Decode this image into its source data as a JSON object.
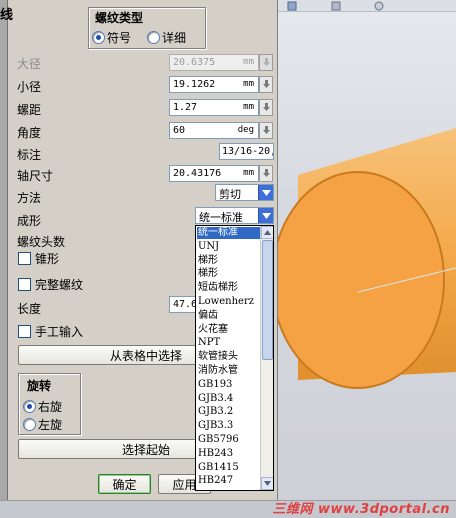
{
  "panel": {
    "title_fragment": "线",
    "thread_type": {
      "title": "螺纹类型",
      "options": [
        "符号",
        "详细"
      ],
      "selected": 0
    },
    "fields": {
      "major_dia": {
        "label": "大径",
        "value": "20.6375",
        "unit": "mm"
      },
      "minor_dia": {
        "label": "小径",
        "value": "19.1262",
        "unit": "mm"
      },
      "pitch": {
        "label": "螺距",
        "value": "1.27",
        "unit": "mm"
      },
      "angle": {
        "label": "角度",
        "value": "60",
        "unit": "deg"
      },
      "callout": {
        "label": "标注",
        "value": "13/16-20,"
      },
      "shaft_size": {
        "label": "轴尺寸",
        "value": "20.43176",
        "unit": "mm"
      }
    },
    "method": {
      "label": "方法",
      "value": "剪切"
    },
    "form": {
      "label": "成形",
      "value": "统一标准"
    },
    "starts_label": "螺纹头数",
    "taper_label": "锥形",
    "full_thread_label": "完整螺纹",
    "length": {
      "label": "长度",
      "value": "47.6"
    },
    "manual_input_label": "手工输入",
    "choose_from_table": "从表格中选择",
    "rotation": {
      "title": "旋转",
      "options": [
        "右旋",
        "左旋"
      ],
      "selected": 0
    },
    "select_start": "选择起始",
    "ok": "确定",
    "apply": "应用"
  },
  "dropdown": {
    "items": [
      "统一标准",
      "UNJ",
      "梯形",
      "梯形",
      "短齿梯形",
      "Lowenherz",
      "偏齿",
      "火花塞",
      "NPT",
      "软管接头",
      "消防水管",
      "GB193",
      "GJB3.4",
      "GJB3.2",
      "GJB3.3",
      "GB5796",
      "HB243",
      "GB1415",
      "HB247"
    ],
    "selected": 0
  },
  "watermark": "三维网 www.3dportal.cn",
  "colors": {
    "accent": "#316ac5",
    "cylinder": "#f4a94a",
    "cylinder_edge": "#c97a1e"
  }
}
